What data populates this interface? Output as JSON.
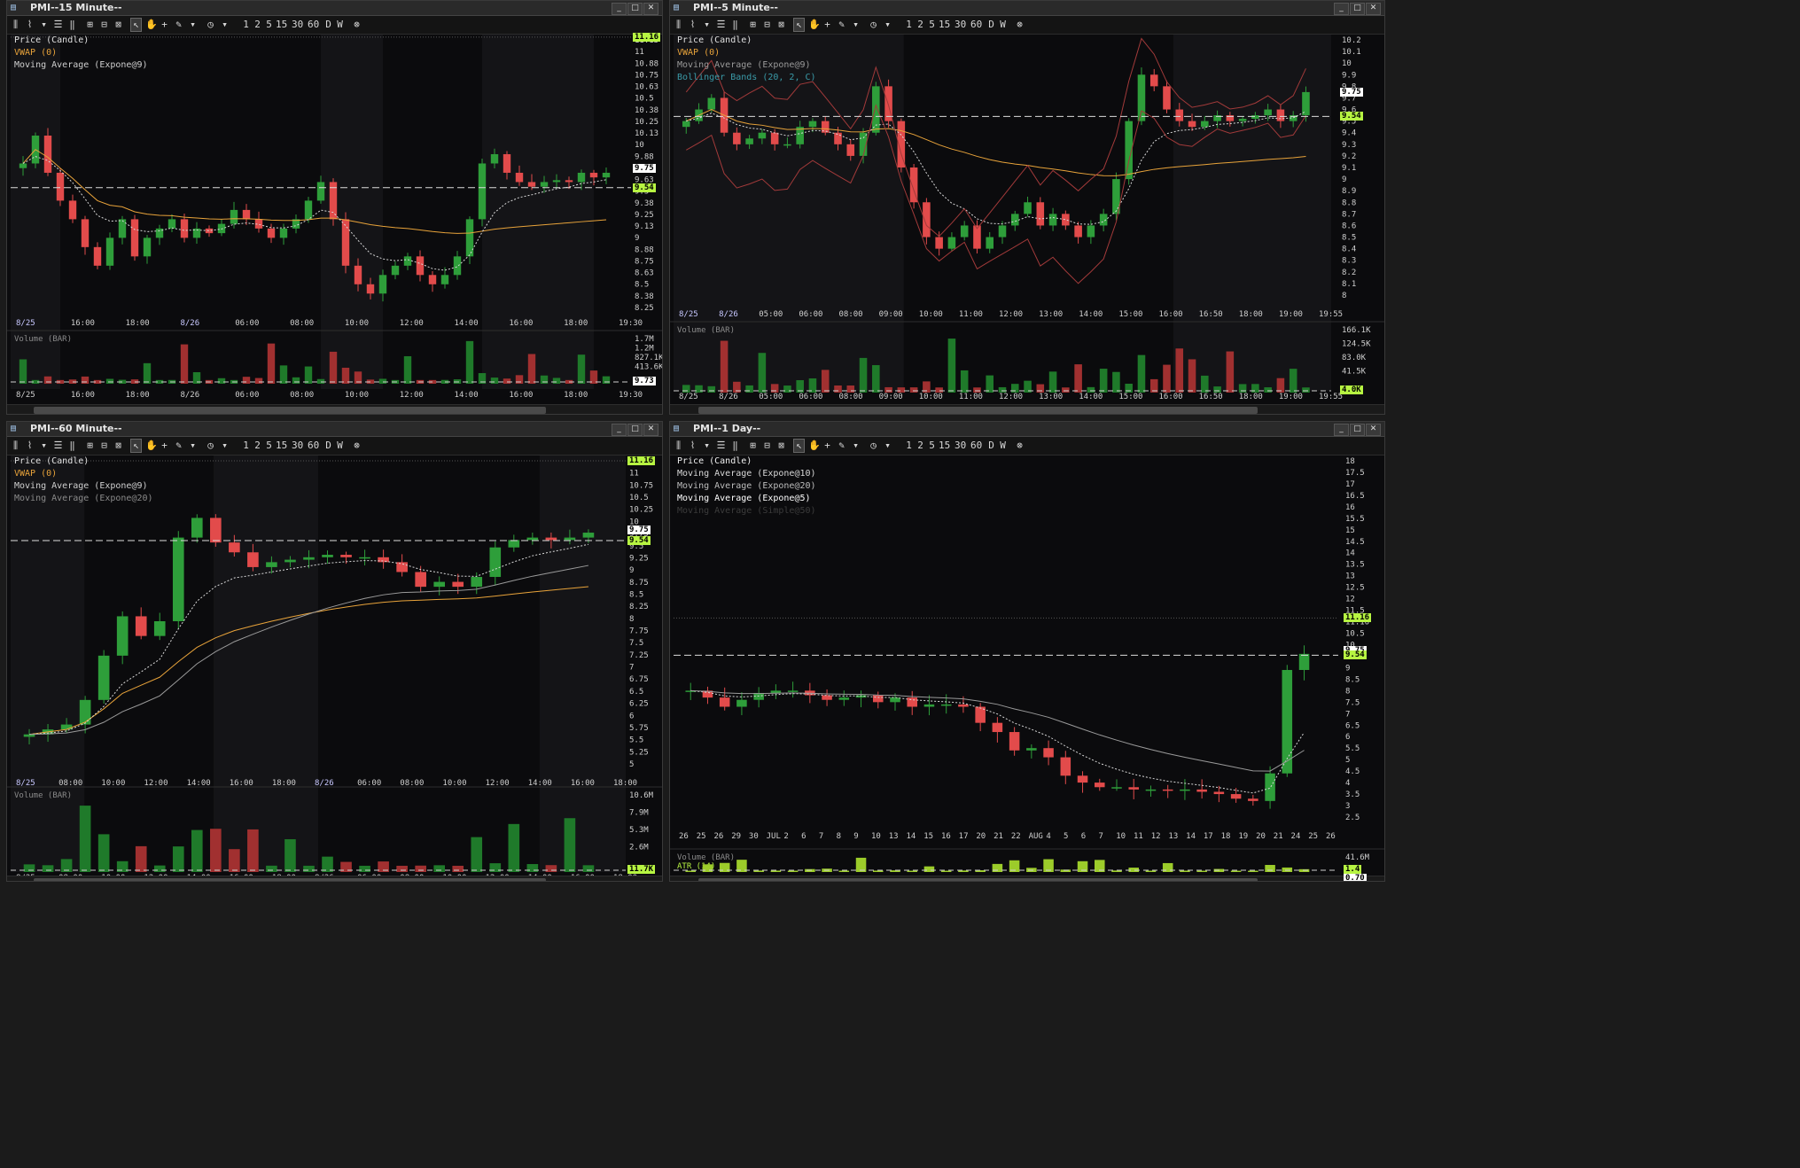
{
  "windows": [
    {
      "id": "w15",
      "title": "PMI--15 Minute--",
      "legend": [
        {
          "text": "Price (Candle)",
          "color": "#e0e0e0"
        },
        {
          "text": "VWAP (0)",
          "color": "#e8a33a"
        },
        {
          "text": "Moving Average (Expone@9)",
          "color": "#cfcfcf"
        }
      ],
      "price_axis": [
        "11.13",
        "11",
        "10.88",
        "10.75",
        "10.63",
        "10.5",
        "10.38",
        "10.25",
        "10.13",
        "10",
        "9.88",
        "9.75",
        "9.63",
        "9.5",
        "9.38",
        "9.25",
        "9.13",
        "9",
        "8.88",
        "8.75",
        "8.63",
        "8.5",
        "8.38",
        "8.25"
      ],
      "time_axis": [
        "8/25",
        "16:00",
        "18:00",
        "8/26",
        "06:00",
        "08:00",
        "10:00",
        "12:00",
        "14:00",
        "16:00",
        "18:00",
        "19:30"
      ],
      "price_tags": {
        "high": "11.16",
        "last": "9.75",
        "bid": "9.54"
      },
      "volume_label": "Volume (BAR)",
      "volume_axis": [
        "1.7M",
        "1.2M",
        "827.1K",
        "413.6K"
      ],
      "volume_tag": "9.73"
    },
    {
      "id": "w5",
      "title": "PMI--5 Minute--",
      "legend": [
        {
          "text": "Price (Candle)",
          "color": "#e0e0e0"
        },
        {
          "text": "VWAP (0)",
          "color": "#e8a33a"
        },
        {
          "text": "Moving Average (Expone@9)",
          "color": "#9a9a9a"
        },
        {
          "text": "Bollinger Bands (20, 2, C)",
          "color": "#3a9aa8"
        }
      ],
      "price_axis": [
        "10.2",
        "10.1",
        "10",
        "9.9",
        "9.8",
        "9.7",
        "9.6",
        "9.5",
        "9.4",
        "9.3",
        "9.2",
        "9.1",
        "9",
        "8.9",
        "8.8",
        "8.7",
        "8.6",
        "8.5",
        "8.4",
        "8.3",
        "8.2",
        "8.1",
        "8"
      ],
      "time_axis": [
        "8/25",
        "8/26",
        "05:00",
        "06:00",
        "08:00",
        "09:00",
        "10:00",
        "11:00",
        "12:00",
        "13:00",
        "14:00",
        "15:00",
        "16:00",
        "16:50",
        "18:00",
        "19:00",
        "19:55"
      ],
      "price_tags": {
        "last": "9.75",
        "bid": "9.54"
      },
      "volume_label": "Volume (BAR)",
      "volume_axis": [
        "166.1K",
        "124.5K",
        "83.0K",
        "41.5K"
      ],
      "volume_tag": "4.0K"
    },
    {
      "id": "w60",
      "title": "PMI--60 Minute--",
      "legend": [
        {
          "text": "Price (Candle)",
          "color": "#e0e0e0"
        },
        {
          "text": "VWAP (0)",
          "color": "#e8a33a"
        },
        {
          "text": "Moving Average (Expone@9)",
          "color": "#cfcfcf"
        },
        {
          "text": "Moving Average (Expone@20)",
          "color": "#8a8a8a"
        }
      ],
      "price_axis": [
        "11.16",
        "11",
        "10.75",
        "10.5",
        "10.25",
        "10",
        "9.75",
        "9.5",
        "9.25",
        "9",
        "8.75",
        "8.5",
        "8.25",
        "8",
        "7.75",
        "7.5",
        "7.25",
        "7",
        "6.75",
        "6.5",
        "6.25",
        "6",
        "5.75",
        "5.5",
        "5.25",
        "5"
      ],
      "time_axis": [
        "8/25",
        "08:00",
        "10:00",
        "12:00",
        "14:00",
        "16:00",
        "18:00",
        "8/26",
        "06:00",
        "08:00",
        "10:00",
        "12:00",
        "14:00",
        "16:00",
        "18:00"
      ],
      "price_tags": {
        "high": "11.16",
        "last": "9.75",
        "bid": "9.54"
      },
      "volume_label": "Volume (BAR)",
      "volume_axis": [
        "10.6M",
        "7.9M",
        "5.3M",
        "2.6M"
      ],
      "volume_tag": "11.7K"
    },
    {
      "id": "w1d",
      "title": "PMI--1 Day--",
      "legend": [
        {
          "text": "Price (Candle)",
          "color": "#f0f0f0"
        },
        {
          "text": "Moving Average (Expone@10)",
          "color": "#d8d8d8"
        },
        {
          "text": "Moving Average (Expone@20)",
          "color": "#bdbdbd"
        },
        {
          "text": "Moving Average (Expone@5)",
          "color": "#ffffff"
        },
        {
          "text": "Moving Average (Simple@50)",
          "color": "#3c3c3c"
        }
      ],
      "price_axis": [
        "18",
        "17.5",
        "17",
        "16.5",
        "16",
        "15.5",
        "15",
        "14.5",
        "14",
        "13.5",
        "13",
        "12.5",
        "12",
        "11.5",
        "11.16",
        "10.5",
        "10",
        "9.5",
        "9",
        "8.5",
        "8",
        "7.5",
        "7",
        "6.5",
        "6",
        "5.5",
        "5",
        "4.5",
        "4",
        "3.5",
        "3",
        "2.5"
      ],
      "time_axis": [
        "26",
        "25",
        "26",
        "29",
        "30",
        "JUL",
        "2",
        "6",
        "7",
        "8",
        "9",
        "10",
        "13",
        "14",
        "15",
        "16",
        "17",
        "20",
        "21",
        "22",
        "AUG",
        "4",
        "5",
        "6",
        "7",
        "10",
        "11",
        "12",
        "13",
        "14",
        "17",
        "18",
        "19",
        "20",
        "21",
        "24",
        "25",
        "26"
      ],
      "price_tags": {
        "high": "11.16",
        "last": "9.75",
        "bid": "9.54"
      },
      "volume_label": "Volume (BAR)",
      "atr_label": "ATR (14)",
      "volume_axis": [
        "41.6M"
      ],
      "volume_tag": "1.4",
      "atr_tag": "0.70"
    }
  ],
  "toolbar_labels": [
    "1",
    "2",
    "5",
    "15",
    "30",
    "60",
    "D",
    "W"
  ],
  "colors": {
    "up": "#2e9e3a",
    "down": "#e24b4b",
    "vwap": "#e8a33a",
    "tag_green": "#b7f542",
    "tag_white": "#ffffff"
  }
}
